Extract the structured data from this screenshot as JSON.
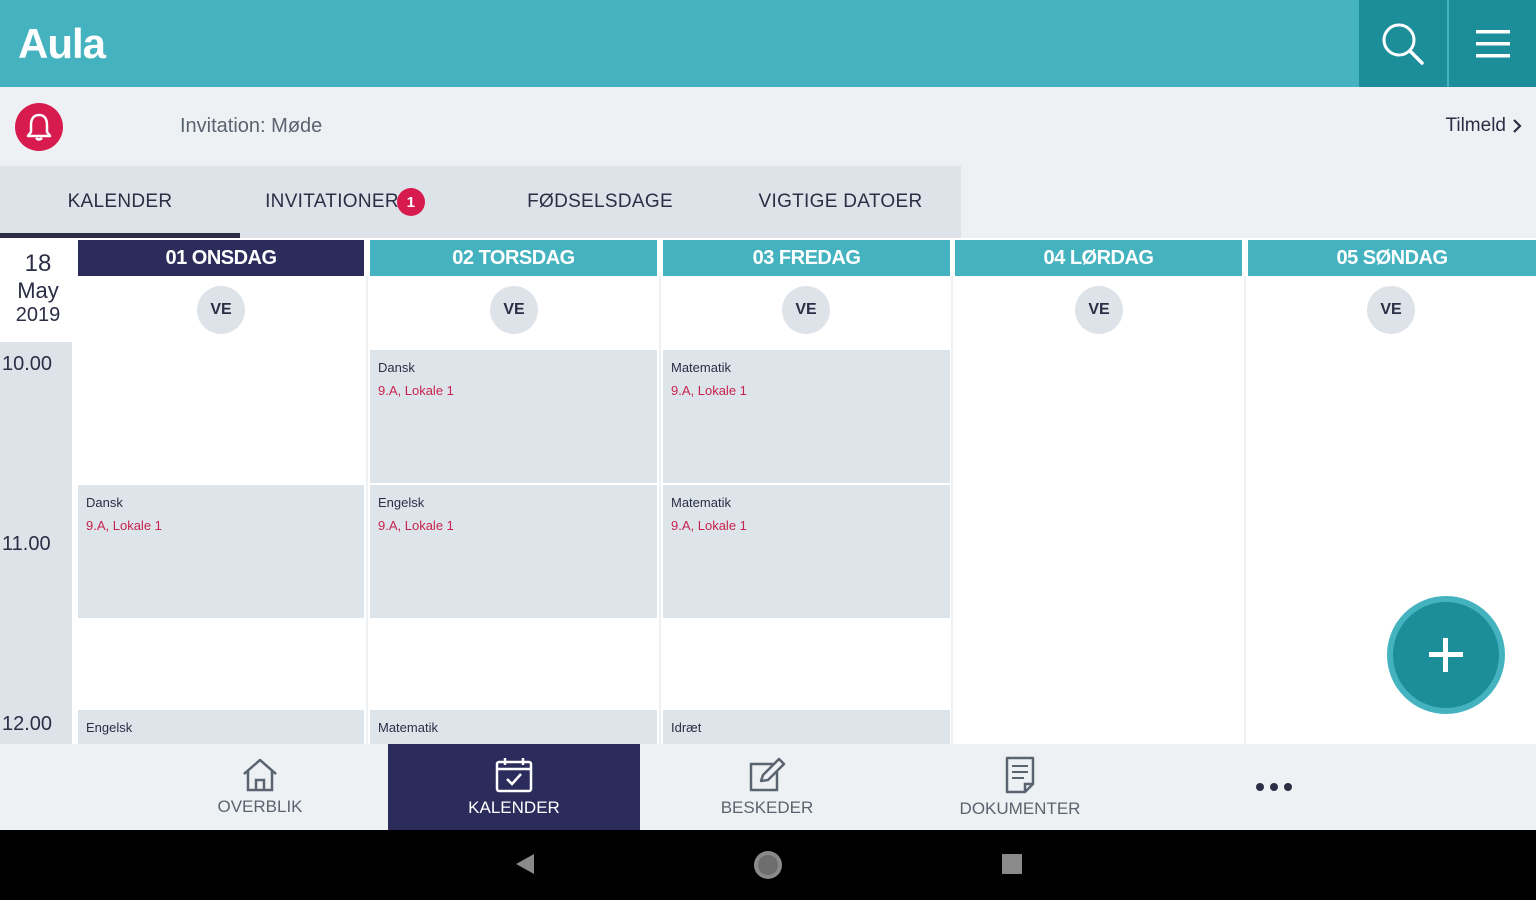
{
  "app": {
    "title": "Aula"
  },
  "notification": {
    "text": "Invitation: Møde",
    "action": "Tilmeld"
  },
  "tabs": [
    {
      "label": "KALENDER",
      "active": true
    },
    {
      "label": "INVITATIONER",
      "badge": "1"
    },
    {
      "label": "FØDSELSDAGE"
    },
    {
      "label": "VIGTIGE DATOER"
    }
  ],
  "date": {
    "day": "18",
    "month": "May",
    "year": "2019"
  },
  "times": [
    "10.00",
    "11.00",
    "12.00"
  ],
  "days": [
    {
      "label": "01 ONSDAG",
      "avatar": "VE",
      "today": true
    },
    {
      "label": "02 TORSDAG",
      "avatar": "VE"
    },
    {
      "label": "03 FREDAG",
      "avatar": "VE"
    },
    {
      "label": "04 LØRDAG",
      "avatar": "VE"
    },
    {
      "label": "05 SØNDAG",
      "avatar": "VE"
    }
  ],
  "events": {
    "thu_1": {
      "subject": "Dansk",
      "location": "9.A, Lokale 1"
    },
    "fri_1": {
      "subject": "Matematik",
      "location": "9.A, Lokale 1"
    },
    "wed_2": {
      "subject": "Dansk",
      "location": "9.A, Lokale 1"
    },
    "thu_2": {
      "subject": "Engelsk",
      "location": "9.A, Lokale 1"
    },
    "fri_2": {
      "subject": "Matematik",
      "location": "9.A, Lokale 1"
    },
    "wed_3": {
      "subject": "Engelsk"
    },
    "thu_3": {
      "subject": "Matematik"
    },
    "fri_3": {
      "subject": "Idræt"
    }
  },
  "bottom_nav": [
    {
      "label": "OVERBLIK",
      "icon": "home-icon"
    },
    {
      "label": "KALENDER",
      "icon": "calendar-icon",
      "active": true
    },
    {
      "label": "BESKEDER",
      "icon": "edit-icon"
    },
    {
      "label": "DOKUMENTER",
      "icon": "document-icon"
    },
    {
      "label": "",
      "icon": "more-icon"
    }
  ],
  "colors": {
    "teal": "#45b3bf",
    "dark_teal": "#1b8e9a",
    "navy": "#2b2b5c",
    "accent_red": "#d81b4f",
    "event_bg": "#dde5eb"
  }
}
